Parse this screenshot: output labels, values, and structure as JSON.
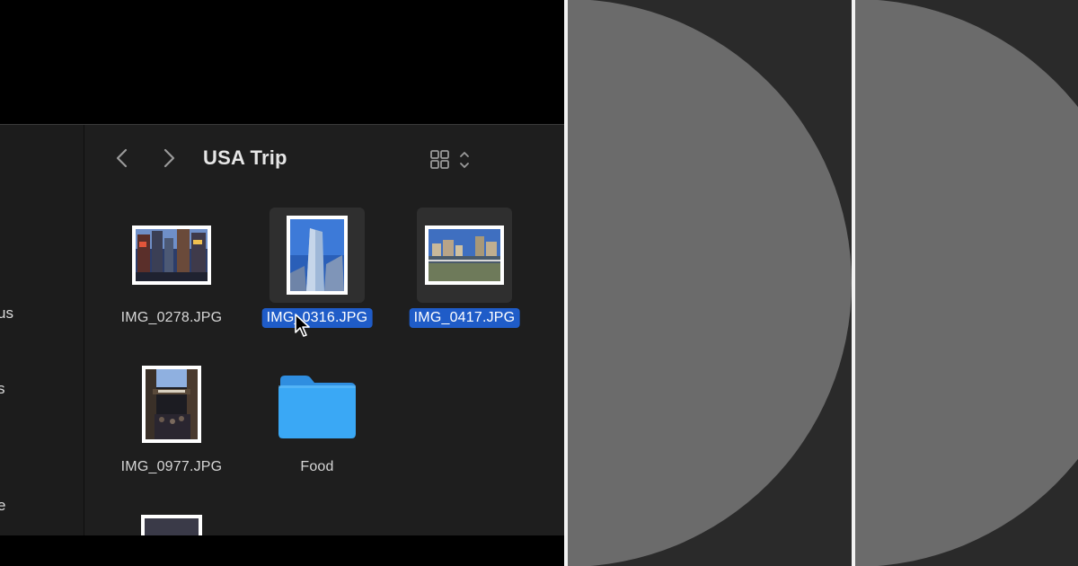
{
  "window": {
    "title": "USA Trip"
  },
  "sidebar": {
    "items": [
      {
        "label": "us"
      },
      {
        "label": "s"
      },
      {
        "label": "e"
      }
    ]
  },
  "toolbar": {
    "back_icon": "chevron-left-icon",
    "forward_icon": "chevron-right-icon",
    "view_icon": "grid-view-icon"
  },
  "files": [
    {
      "name": "IMG_0278.JPG",
      "kind": "photo",
      "selected": false
    },
    {
      "name": "IMG_0316.JPG",
      "kind": "photo",
      "selected": true
    },
    {
      "name": "IMG_0417.JPG",
      "kind": "photo",
      "selected": true
    },
    {
      "name": "IMG_0977.JPG",
      "kind": "photo",
      "selected": false
    },
    {
      "name": "Food",
      "kind": "folder",
      "selected": false
    }
  ],
  "colors": {
    "selection": "#1f5cc8",
    "folder": "#3aa0f0",
    "window_bg": "#1e1e1e",
    "panel_bg": "#2a2a2a",
    "circle": "#6b6b6b"
  }
}
